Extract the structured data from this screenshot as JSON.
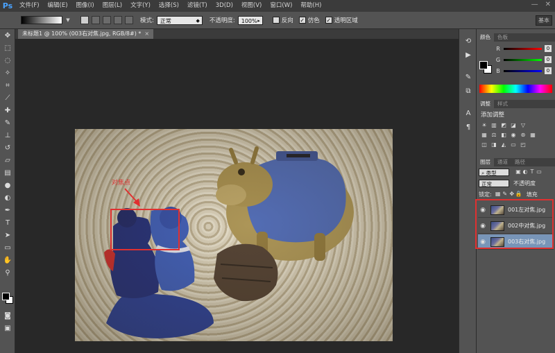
{
  "app": {
    "logo": "Ps",
    "menus": [
      "文件(F)",
      "编辑(E)",
      "图像(I)",
      "图层(L)",
      "文字(Y)",
      "选择(S)",
      "滤镜(T)",
      "3D(D)",
      "视图(V)",
      "窗口(W)",
      "帮助(H)"
    ],
    "window_controls": {
      "minimize": "—",
      "close": "✕"
    }
  },
  "options": {
    "mode_label": "模式:",
    "mode_value": "正常",
    "opacity_label": "不透明度:",
    "opacity_value": "100%",
    "reverse_label": "反向",
    "dither_label": "仿色",
    "transparency_label": "透明区域",
    "workspace_label": "基本"
  },
  "document": {
    "tab_title": "未标题1 @ 100% (003右对焦.jpg, RGB/8#) *",
    "close": "×",
    "annotation_label": "对焦点"
  },
  "color_panel": {
    "tabs": [
      "颜色",
      "色板"
    ],
    "channels": [
      {
        "label": "R",
        "value": "0"
      },
      {
        "label": "G",
        "value": "0"
      },
      {
        "label": "B",
        "value": "0"
      }
    ]
  },
  "adjustments_panel": {
    "tabs": [
      "调整",
      "样式"
    ],
    "title": "添加调整"
  },
  "layers_panel": {
    "tabs": [
      "图层",
      "通道",
      "路径"
    ],
    "filter_label": "类型",
    "blend_mode": "正常",
    "opacity_label": "不透明度",
    "lock_label": "锁定:",
    "fill_label": "填充",
    "layers": [
      {
        "name": "001左对焦.jpg",
        "active": false
      },
      {
        "name": "002中对焦.jpg",
        "active": false
      },
      {
        "name": "003右对焦.jpg",
        "active": true
      }
    ]
  },
  "colors": {
    "highlight": "#e03030",
    "selected_layer": "#7895b8",
    "ps_blue": "#4aa3ff"
  }
}
